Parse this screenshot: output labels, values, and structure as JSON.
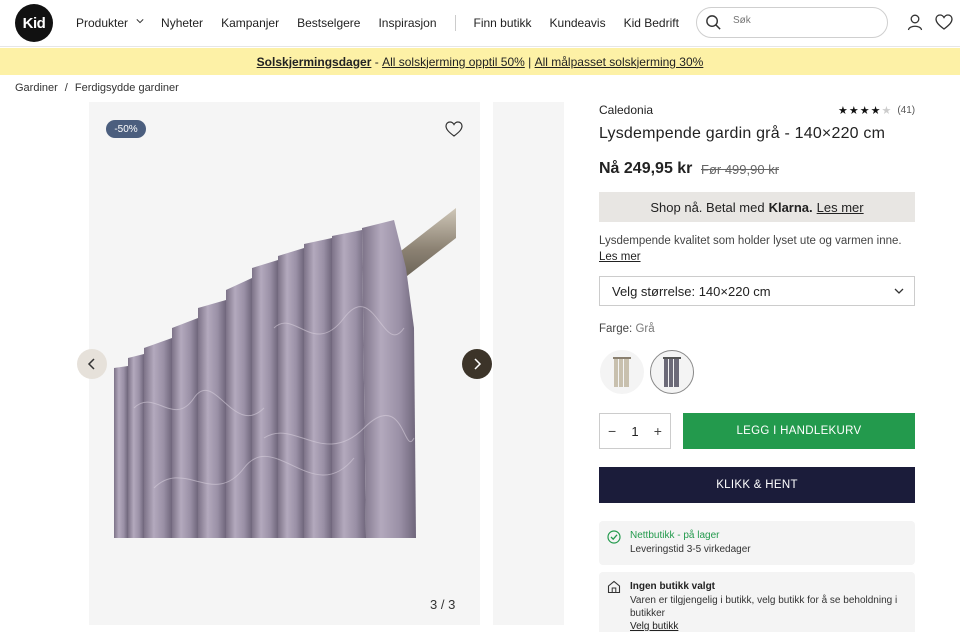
{
  "header": {
    "logo": "Kid",
    "nav": [
      "Produkter",
      "Nyheter",
      "Kampanjer",
      "Bestselgere",
      "Inspirasjon"
    ],
    "nav_secondary": [
      "Finn butikk",
      "Kundeavis",
      "Kid Bedrift"
    ],
    "search_placeholder": "Søk"
  },
  "banner": {
    "bold": "Solskjermingsdager",
    "dash": " - ",
    "offer1": "All solskjerming opptil 50%",
    "divider": " | ",
    "offer2": "All målpasset solskjerming 30%"
  },
  "breadcrumb": [
    "Gardiner",
    "Ferdigsydde gardiner"
  ],
  "gallery": {
    "badge": "-50%",
    "counter": "3 / 3"
  },
  "product": {
    "brand": "Caledonia",
    "rating_stars": 4,
    "rating_count": "(41)",
    "title": "Lysdempende gardin grå - 140×220 cm",
    "price": "Nå 249,95 kr",
    "old_price": "Før 499,90 kr",
    "klarna_text": "Shop nå. Betal med",
    "klarna_brand": "Klarna.",
    "klarna_more": "Les mer",
    "description": "Lysdempende kvalitet som holder lyset ute og varmen inne.",
    "description_more": "Les mer",
    "size_select": "Velg størrelse: 140×220 cm",
    "color_label": "Farge:",
    "color_value": "Grå",
    "quantity": "1",
    "add_to_cart": "LEGG I HANDLEKURV",
    "click_collect": "KLIKK & HENT"
  },
  "availability": {
    "online_status": "Nettbutikk - på lager",
    "delivery": "Leveringstid 3-5 virkedager",
    "store_title": "Ingen butikk valgt",
    "store_text": "Varen er tilgjengelig i butikk, velg butikk for å se beholdning i butikker",
    "store_link": "Velg butikk"
  },
  "colors": {
    "banner_bg": "#fdf1a6",
    "cart_green": "#239a4d",
    "navy": "#1b1c3a",
    "badge": "#4b5e7e",
    "curtain": "#a69bb2"
  }
}
